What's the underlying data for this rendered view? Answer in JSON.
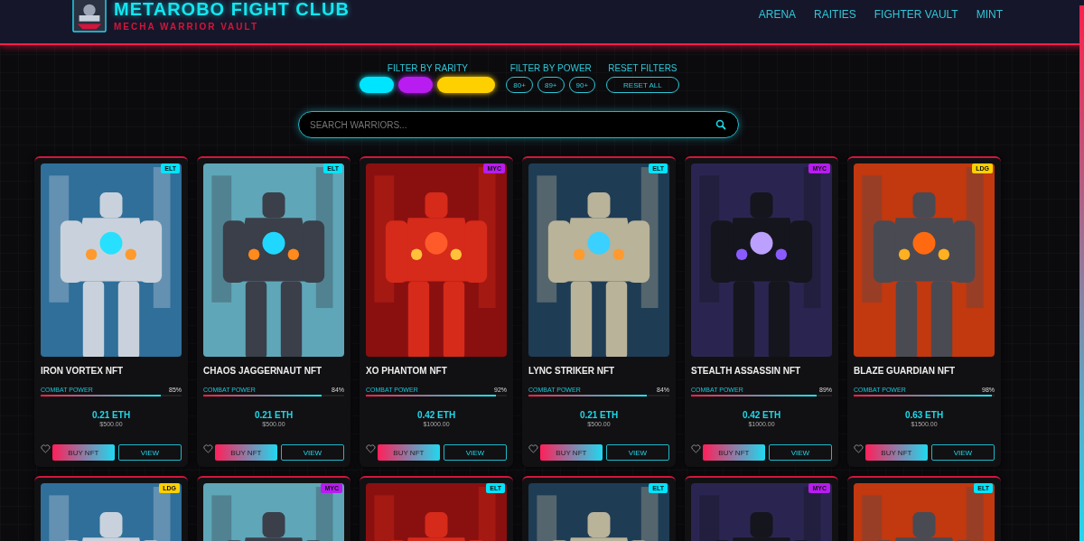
{
  "header": {
    "title": "METAROBO FIGHT CLUB",
    "subtitle": "MECHA WARRIOR VAULT",
    "nav": [
      "ARENA",
      "RAITIES",
      "FIGHTER VAULT",
      "MINT"
    ]
  },
  "filters": {
    "rarity_label": "FILTER BY RARITY",
    "rarity_options": [
      {
        "color": "#00e5ff"
      },
      {
        "color": "#b81cf0"
      },
      {
        "color": "#ffd000"
      }
    ],
    "power_label": "FILTER BY POWER",
    "power_options": [
      "80+",
      "89+",
      "90+"
    ],
    "reset_label": "RESET FILTERS",
    "reset_button": "RESET ALL"
  },
  "search": {
    "placeholder": "SEARCH WARRIORS..."
  },
  "cards": [
    {
      "kind": "full",
      "badge": "ELT",
      "color": "#00e5ff",
      "name": "IRON VORTEX NFT",
      "power_label": "COMBAT POWER",
      "power": "85%",
      "level": 0.85,
      "eth": "0.21 ETH",
      "usd": "$500.00",
      "buy": "BUY NFT",
      "view": "VIEW"
    },
    {
      "kind": "full",
      "badge": "ELT",
      "color": "#00e5ff",
      "name": "CHAOS JAGGERNAUT NFT",
      "power_label": "COMBAT POWER",
      "power": "84%",
      "level": 0.84,
      "eth": "0.21 ETH",
      "usd": "$500.00",
      "buy": "BUY NFT",
      "view": "VIEW"
    },
    {
      "kind": "full",
      "badge": "MYC",
      "color": "#b81cf0",
      "name": "XO PHANTOM NFT",
      "power_label": "COMBAT POWER",
      "power": "92%",
      "level": 0.92,
      "eth": "0.42 ETH",
      "usd": "$1000.00",
      "buy": "BUY NFT",
      "view": "VIEW"
    },
    {
      "kind": "full",
      "badge": "ELT",
      "color": "#00e5ff",
      "name": "LYNC STRIKER NFT",
      "power_label": "COMBAT POWER",
      "power": "84%",
      "level": 0.84,
      "eth": "0.21 ETH",
      "usd": "$500.00",
      "buy": "BUY NFT",
      "view": "VIEW"
    },
    {
      "kind": "full",
      "badge": "MYC",
      "color": "#b81cf0",
      "name": "STEALTH ASSASSIN NFT",
      "power_label": "COMBAT POWER",
      "power": "89%",
      "level": 0.89,
      "eth": "0.42 ETH",
      "usd": "$1000.00",
      "buy": "BUY NFT",
      "view": "VIEW"
    },
    {
      "kind": "full",
      "badge": "LDG",
      "color": "#ffd000",
      "name": "BLAZE GUARDIAN NFT",
      "power_label": "COMBAT POWER",
      "power": "98%",
      "level": 0.98,
      "eth": "0.63 ETH",
      "usd": "$1500.00",
      "buy": "BUY NFT",
      "view": "VIEW"
    },
    {
      "kind": "cut",
      "badge": "LDG",
      "color": "#ffd000"
    },
    {
      "kind": "cut",
      "badge": "MYC",
      "color": "#b81cf0"
    },
    {
      "kind": "cut",
      "badge": "ELT",
      "color": "#00e5ff"
    },
    {
      "kind": "cut",
      "badge": "ELT",
      "color": "#00e5ff"
    },
    {
      "kind": "cut",
      "badge": "MYC",
      "color": "#b81cf0"
    },
    {
      "kind": "cut",
      "badge": "ELT",
      "color": "#00e5ff"
    }
  ]
}
